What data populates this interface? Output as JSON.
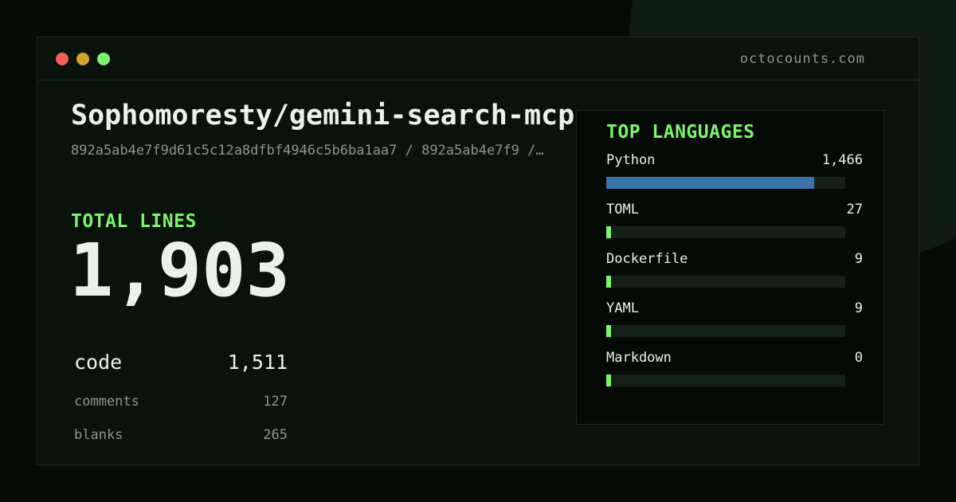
{
  "window": {
    "domain": "octocounts.com",
    "controls": {
      "close_color": "#f25f58",
      "minimize_color": "#d4a329",
      "maximize_color": "#7cf46c"
    }
  },
  "repo": {
    "title": "Sophomoresty/gemini-search-mcp",
    "commit_line": "892a5ab4e7f9d61c5c12a8dfbf4946c5b6ba1aa7 / 892a5ab4e7f9 /…"
  },
  "totals": {
    "label": "TOTAL LINES",
    "value": "1,903",
    "rows": [
      {
        "name": "code",
        "value": "1,511"
      },
      {
        "name": "comments",
        "value": "127"
      },
      {
        "name": "blanks",
        "value": "265"
      }
    ]
  },
  "languages": {
    "title": "TOP LANGUAGES",
    "items": [
      {
        "name": "Python",
        "value": "1,466",
        "share": 0.87,
        "color": "#3a73a8"
      },
      {
        "name": "TOML",
        "value": "27",
        "share": 0.02,
        "color": "#7cf46c"
      },
      {
        "name": "Dockerfile",
        "value": "9",
        "share": 0.02,
        "color": "#7cf46c"
      },
      {
        "name": "YAML",
        "value": "9",
        "share": 0.02,
        "color": "#7cf46c"
      },
      {
        "name": "Markdown",
        "value": "0",
        "share": 0.02,
        "color": "#7cf46c"
      }
    ]
  },
  "colors": {
    "accent": "#7cf46c",
    "text": "#e9f3e7",
    "muted": "#8a978c",
    "background": "#070b08"
  }
}
